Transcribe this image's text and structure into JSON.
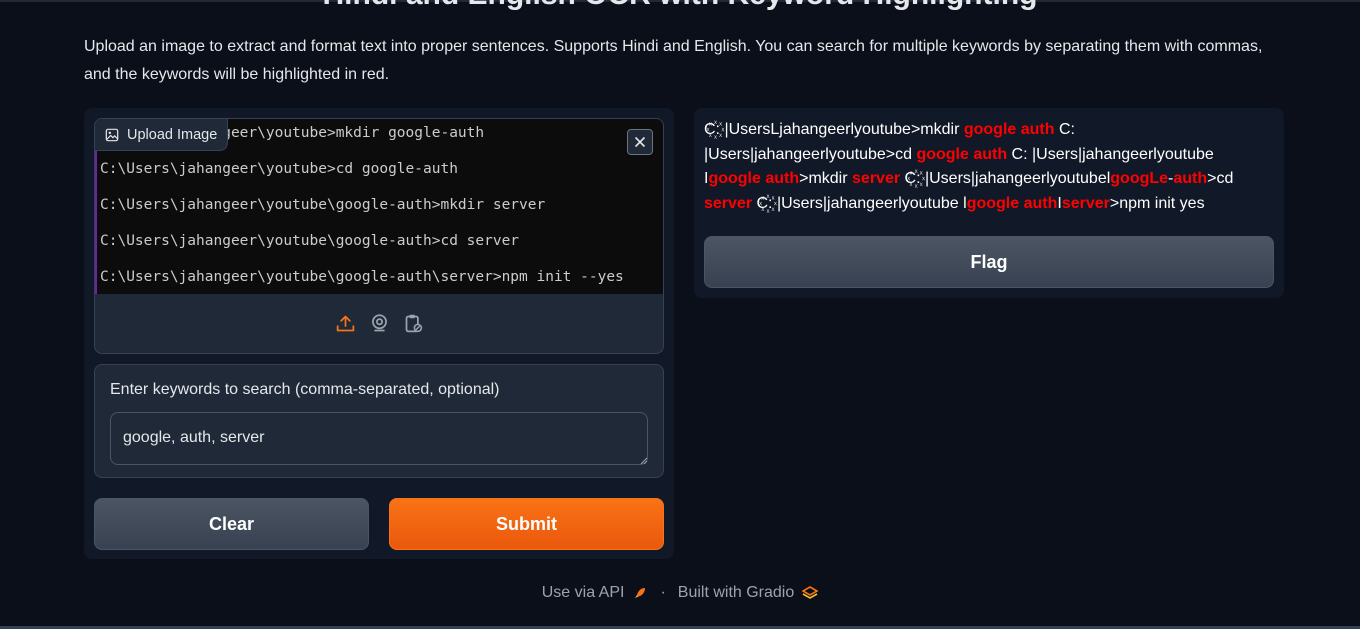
{
  "app": {
    "title_partial": "Hindi and English OCR with Keyword Highlighting",
    "description": "Upload an image to extract and format text into proper sentences. Supports Hindi and English. You can search for multiple keywords by separating them with commas, and the keywords will be highlighted in red."
  },
  "image_input": {
    "tab_label": "Upload Image",
    "terminal_lines": [
      "C:\\Users\\jahangeer\\youtube>mkdir google-auth",
      "C:\\Users\\jahangeer\\youtube>cd google-auth",
      "C:\\Users\\jahangeer\\youtube\\google-auth>mkdir server",
      "C:\\Users\\jahangeer\\youtube\\google-auth>cd server",
      "C:\\Users\\jahangeer\\youtube\\google-auth\\server>npm init --yes"
    ],
    "source_icons": [
      "upload-icon",
      "webcam-icon",
      "clipboard-icon"
    ]
  },
  "keywords": {
    "label": "Enter keywords to search (comma-separated, optional)",
    "value": "google, auth, server"
  },
  "buttons": {
    "clear": "Clear",
    "submit": "Submit",
    "flag": "Flag"
  },
  "output": {
    "segments": [
      {
        "t": "C꙰: |UsersLjahangeerlyoutube>mkdir ",
        "h": false
      },
      {
        "t": "google auth",
        "h": true
      },
      {
        "t": " C: |Users|jahangeerlyoutube>cd ",
        "h": false
      },
      {
        "t": "google auth",
        "h": true
      },
      {
        "t": " C: |Users|jahangeerlyoutube I",
        "h": false
      },
      {
        "t": "google auth",
        "h": true
      },
      {
        "t": ">mkdir ",
        "h": false
      },
      {
        "t": "server",
        "h": true
      },
      {
        "t": " C꙰: |Users|jahangeerlyoutubel",
        "h": false
      },
      {
        "t": "googLe",
        "h": true
      },
      {
        "t": "-",
        "h": false
      },
      {
        "t": "auth",
        "h": true
      },
      {
        "t": ">cd ",
        "h": false
      },
      {
        "t": "server",
        "h": true
      },
      {
        "t": " C꙰: |Users|jahangeerlyoutube l",
        "h": false
      },
      {
        "t": "google auth",
        "h": true
      },
      {
        "t": "I",
        "h": false
      },
      {
        "t": "server",
        "h": true
      },
      {
        "t": ">npm init yes",
        "h": false
      }
    ]
  },
  "footer": {
    "api_label": "Use via API",
    "built_label": "Built with Gradio",
    "separator": "·"
  },
  "colors": {
    "background": "#0b0f19",
    "panel": "#111827",
    "block": "#1f2937",
    "accent": "#f97316",
    "highlight": "#ff0000"
  }
}
